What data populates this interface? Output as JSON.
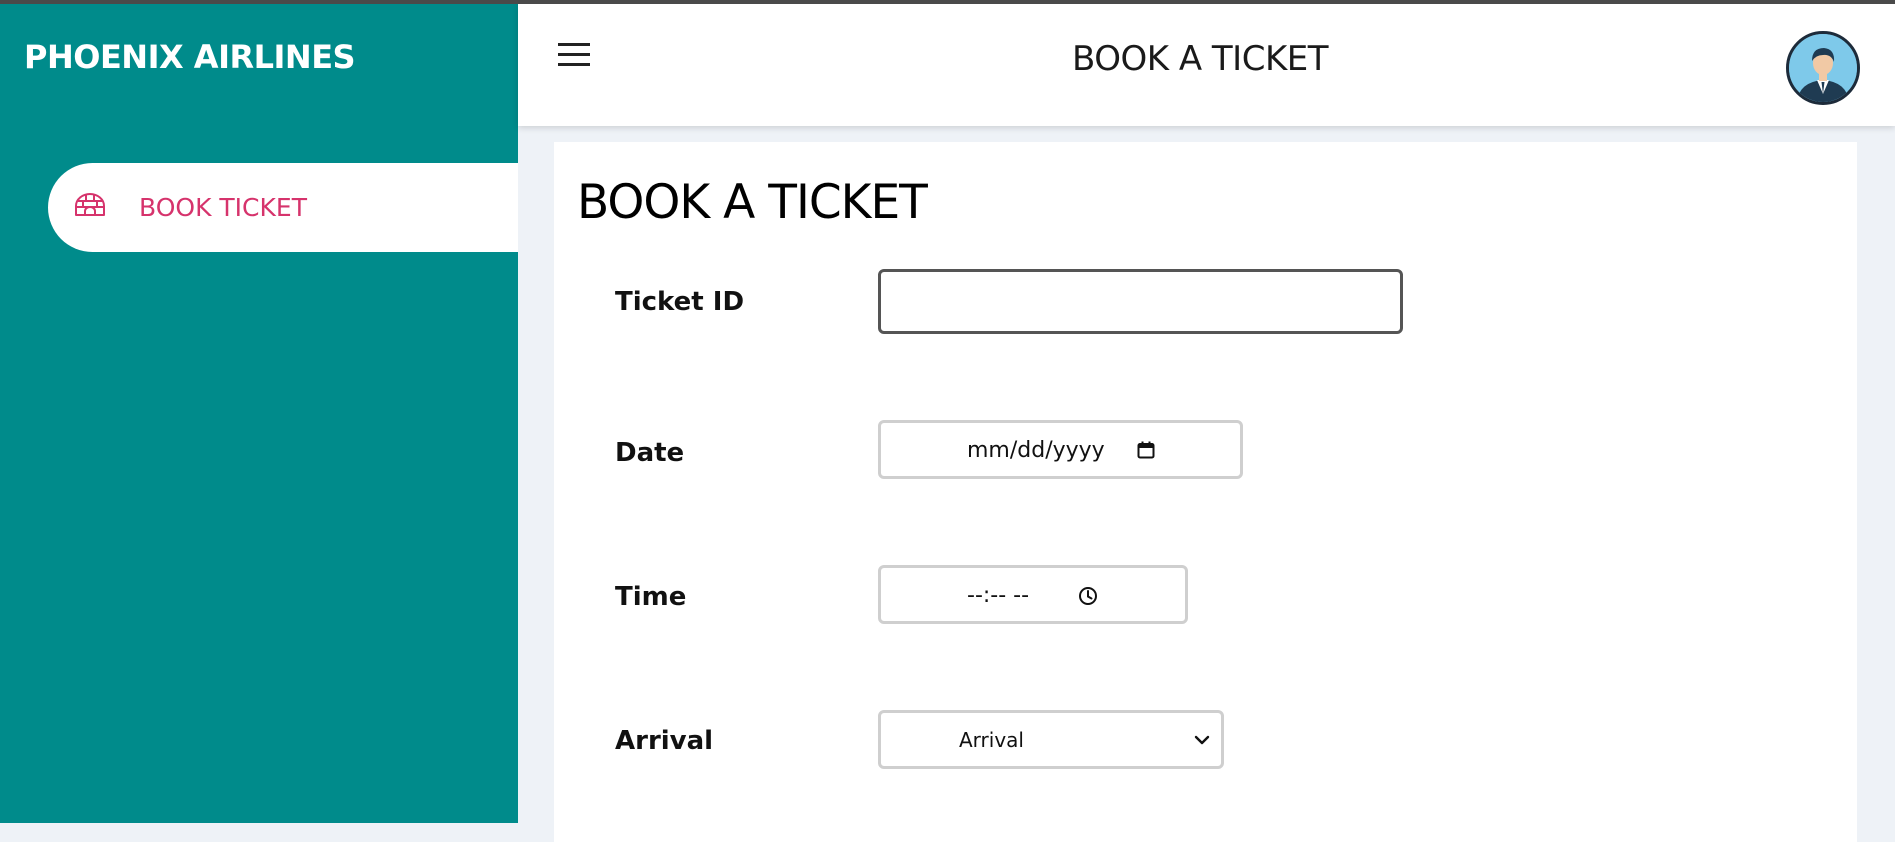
{
  "app": {
    "brand": "PHOENIX AIRLINES",
    "title": "BOOK A TICKET"
  },
  "colors": {
    "sidebar": "#008b8b",
    "active_nav_text": "#d6336c",
    "page_background": "#eef2f7"
  },
  "sidebar": {
    "items": [
      {
        "label": "BOOK TICKET",
        "icon": "igloo-icon",
        "active": true
      }
    ]
  },
  "header": {
    "menu_icon": "hamburger-menu-icon",
    "avatar_icon": "user-avatar-icon"
  },
  "main": {
    "heading": "BOOK A TICKET",
    "form": {
      "ticket_id": {
        "label": "Ticket ID",
        "value": ""
      },
      "date": {
        "label": "Date",
        "display": "mm/dd/yyyy",
        "icon": "calendar-icon"
      },
      "time": {
        "label": "Time",
        "display": "--:-- --",
        "icon": "clock-icon"
      },
      "arrival": {
        "label": "Arrival",
        "selected": "Arrival",
        "icon": "chevron-down-icon"
      }
    }
  }
}
